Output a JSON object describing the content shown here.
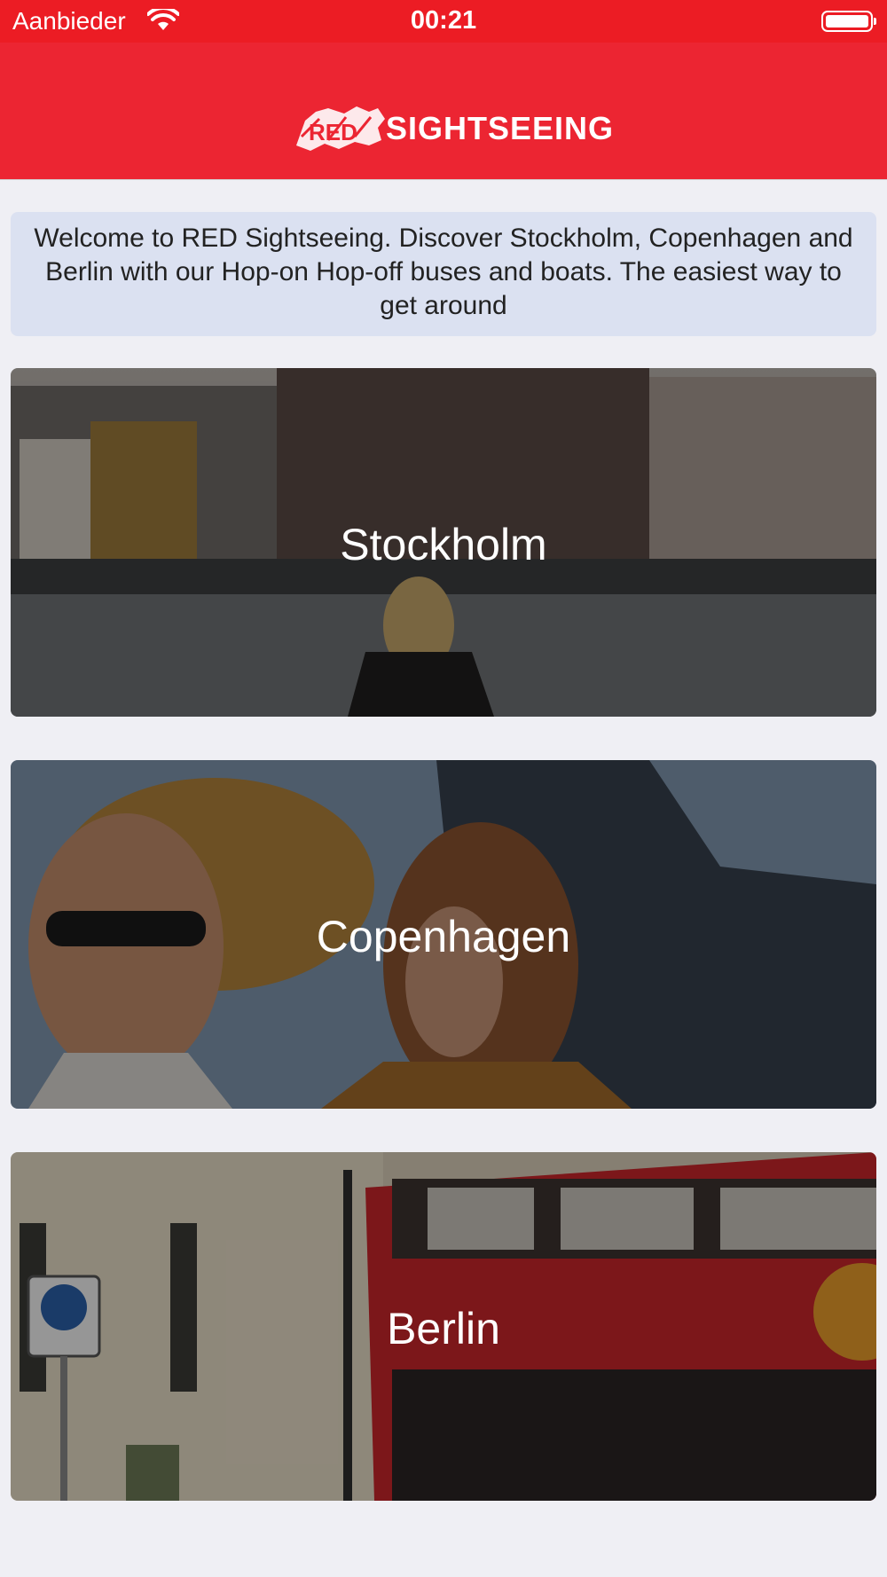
{
  "status_bar": {
    "carrier": "Aanbieder",
    "time": "00:21",
    "icons": [
      "wifi-icon",
      "battery-icon"
    ]
  },
  "header": {
    "logo_text": "RED SIGHTSEEING",
    "brand_color": "#ec2532"
  },
  "welcome": {
    "text": "Welcome to RED Sightseeing. Discover Stockholm, Copenhagen and Berlin with our Hop-on Hop-off buses and boats. The easiest way to get around"
  },
  "cities": [
    {
      "name": "Stockholm"
    },
    {
      "name": "Copenhagen"
    },
    {
      "name": "Berlin"
    }
  ]
}
